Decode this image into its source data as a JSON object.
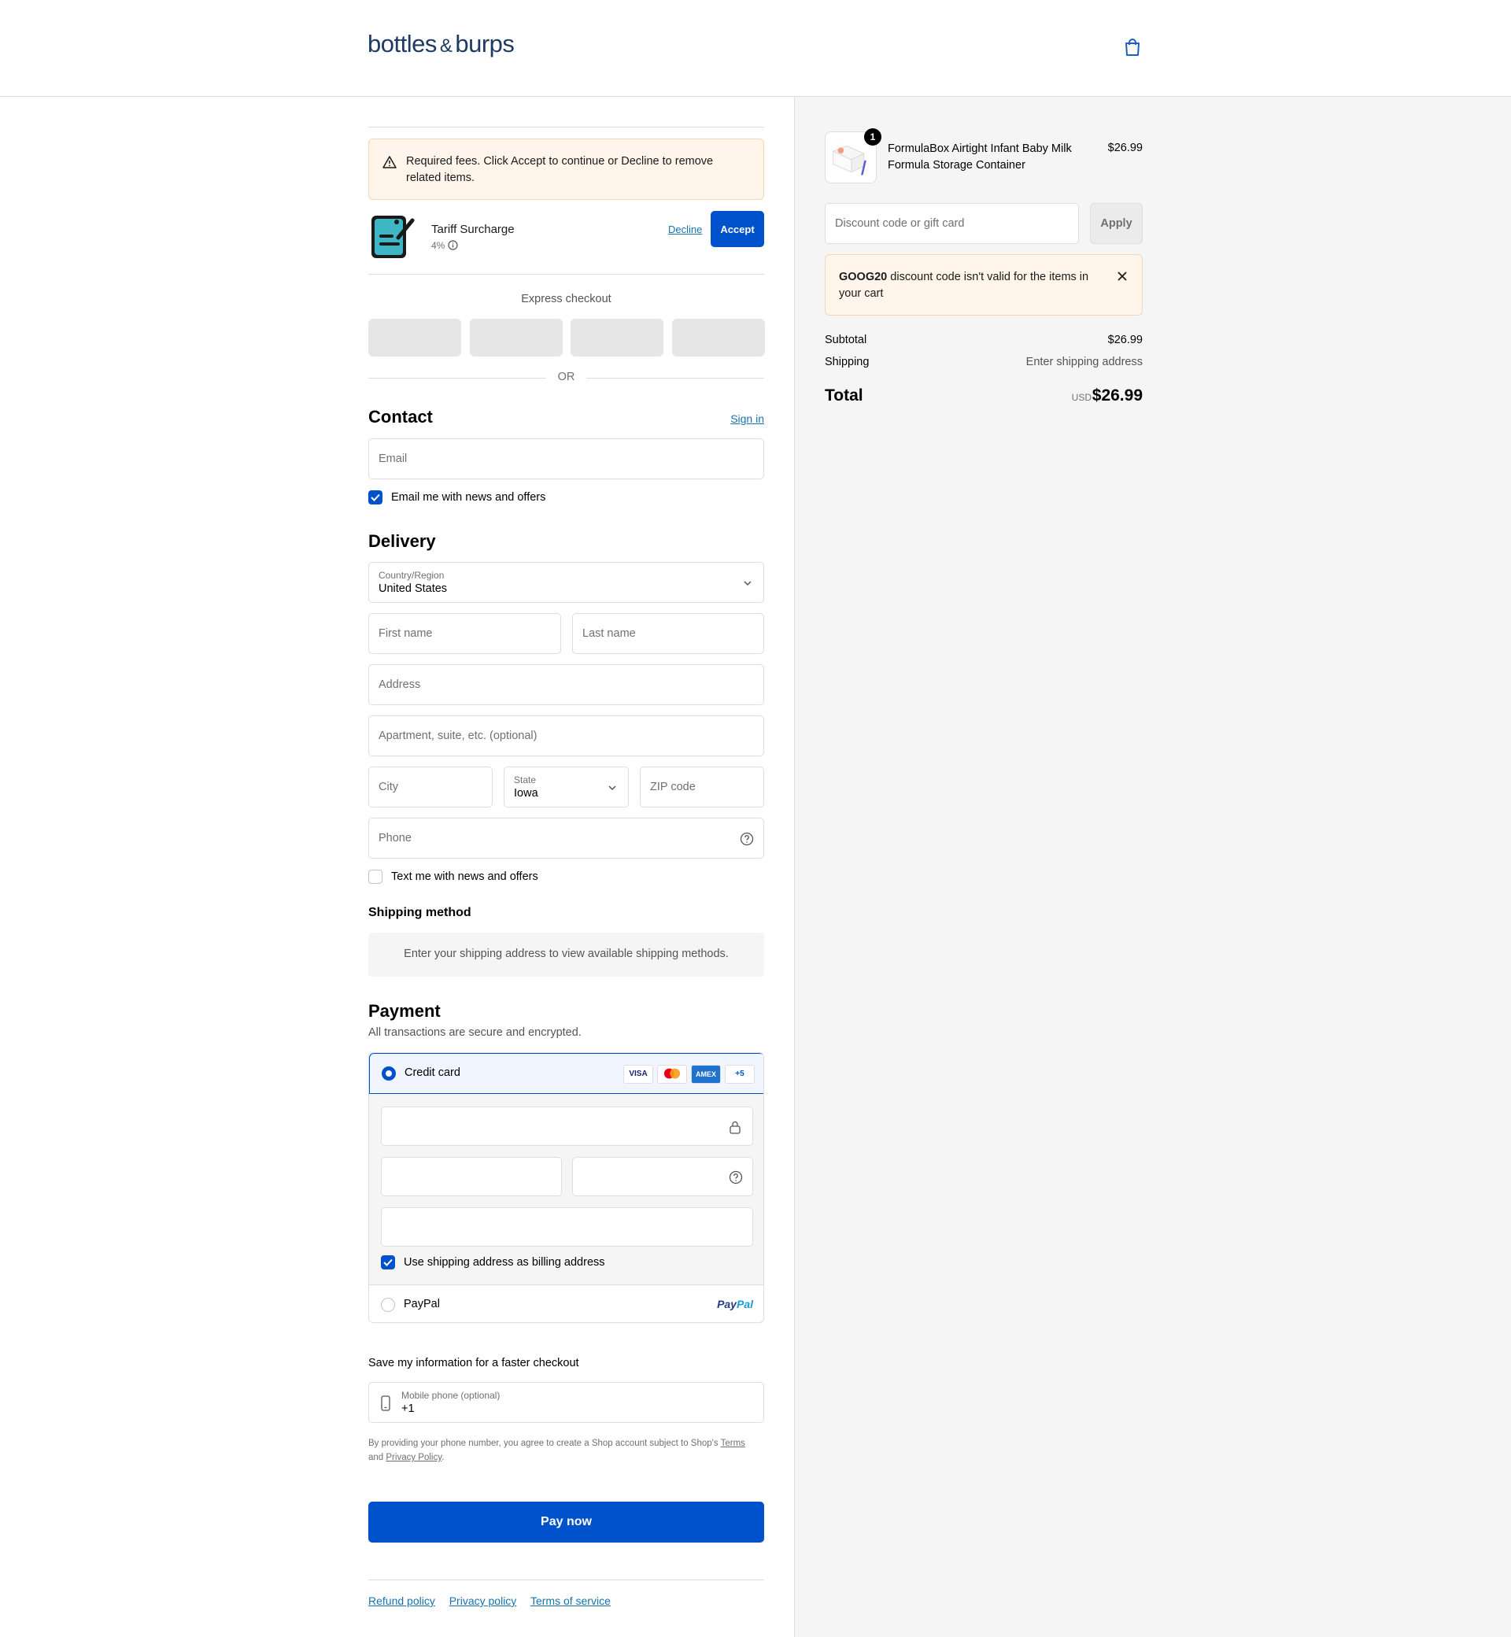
{
  "header": {
    "logo_part1": "bottles",
    "logo_amp": "&",
    "logo_part2": "burps"
  },
  "fees": {
    "warning": "Required fees. Click Accept to continue or Decline to remove related items.",
    "item_name": "Tariff Surcharge",
    "item_rate": "4%",
    "decline": "Decline",
    "accept": "Accept"
  },
  "express": {
    "title": "Express checkout",
    "or": "OR"
  },
  "contact": {
    "title": "Contact",
    "sign_in": "Sign in",
    "email_placeholder": "Email",
    "news_label": "Email me with news and offers",
    "news_checked": true
  },
  "delivery": {
    "title": "Delivery",
    "country_label": "Country/Region",
    "country_value": "United States",
    "first_name": "First name",
    "last_name": "Last name",
    "address": "Address",
    "apartment": "Apartment, suite, etc. (optional)",
    "city": "City",
    "state_label": "State",
    "state_value": "Iowa",
    "zip": "ZIP code",
    "phone": "Phone",
    "text_label": "Text me with news and offers",
    "text_checked": false
  },
  "shipping": {
    "title": "Shipping method",
    "message": "Enter your shipping address to view available shipping methods."
  },
  "payment": {
    "title": "Payment",
    "subtitle": "All transactions are secure and encrypted.",
    "credit_card": "Credit card",
    "cards": [
      "VISA",
      "MC",
      "AMEX",
      "+5"
    ],
    "billing_label": "Use shipping address as billing address",
    "billing_checked": true,
    "paypal": "PayPal",
    "paypal_logo_a": "Pay",
    "paypal_logo_b": "Pal"
  },
  "save": {
    "title": "Save my information for a faster checkout",
    "phone_label": "Mobile phone (optional)",
    "phone_value": "+1",
    "legal_prefix": "By providing your phone number, you agree to create a Shop account subject to Shop's",
    "terms": "Terms",
    "and": "and",
    "privacy": "Privacy Policy"
  },
  "pay_now": "Pay now",
  "footer": {
    "refund": "Refund policy",
    "privacy": "Privacy policy",
    "terms": "Terms of service"
  },
  "summary": {
    "product_name": "FormulaBox Airtight Infant Baby Milk Formula Storage Container",
    "product_qty": "1",
    "product_price": "$26.99",
    "discount_placeholder": "Discount code or gift card",
    "apply": "Apply",
    "error_code": "GOOG20",
    "error_text": "discount code isn't valid for the items in your cart",
    "subtotal_label": "Subtotal",
    "subtotal_value": "$26.99",
    "shipping_label": "Shipping",
    "shipping_value": "Enter shipping address",
    "total_label": "Total",
    "currency": "USD",
    "total_value": "$26.99"
  },
  "colors": {
    "primary": "#0052cc",
    "link": "#1773b0",
    "warning_bg": "#fff5ea",
    "panel_bg": "#f5f5f5"
  }
}
